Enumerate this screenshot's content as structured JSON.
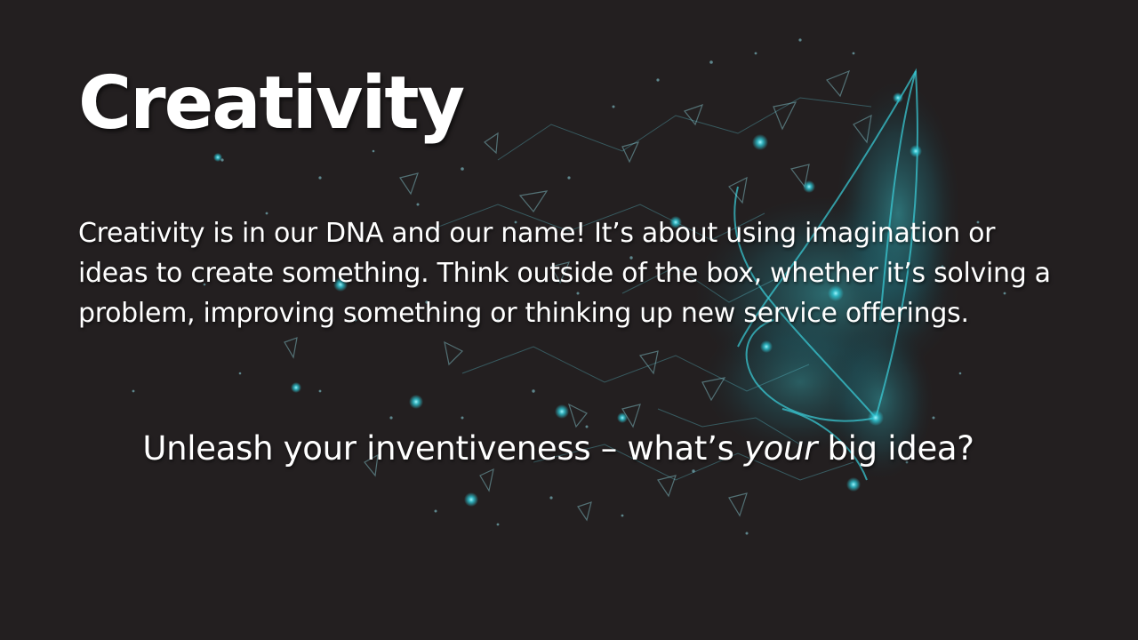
{
  "slide": {
    "title": "Creativity",
    "body": "Creativity is in our DNA and our name! It’s about using imagination or ideas to create something. Think outside of the box, whether it’s solving a problem, improving something or thinking up new service offerings.",
    "tagline_before": "Unleash your inventiveness – what’s ",
    "tagline_emphasis": "your",
    "tagline_after": " big idea?"
  },
  "colors": {
    "background": "#231f20",
    "text": "#ffffff",
    "accent_glow": "#2ec8d6"
  },
  "icons": {
    "background_art": "butterfly-network-illustration-icon"
  }
}
